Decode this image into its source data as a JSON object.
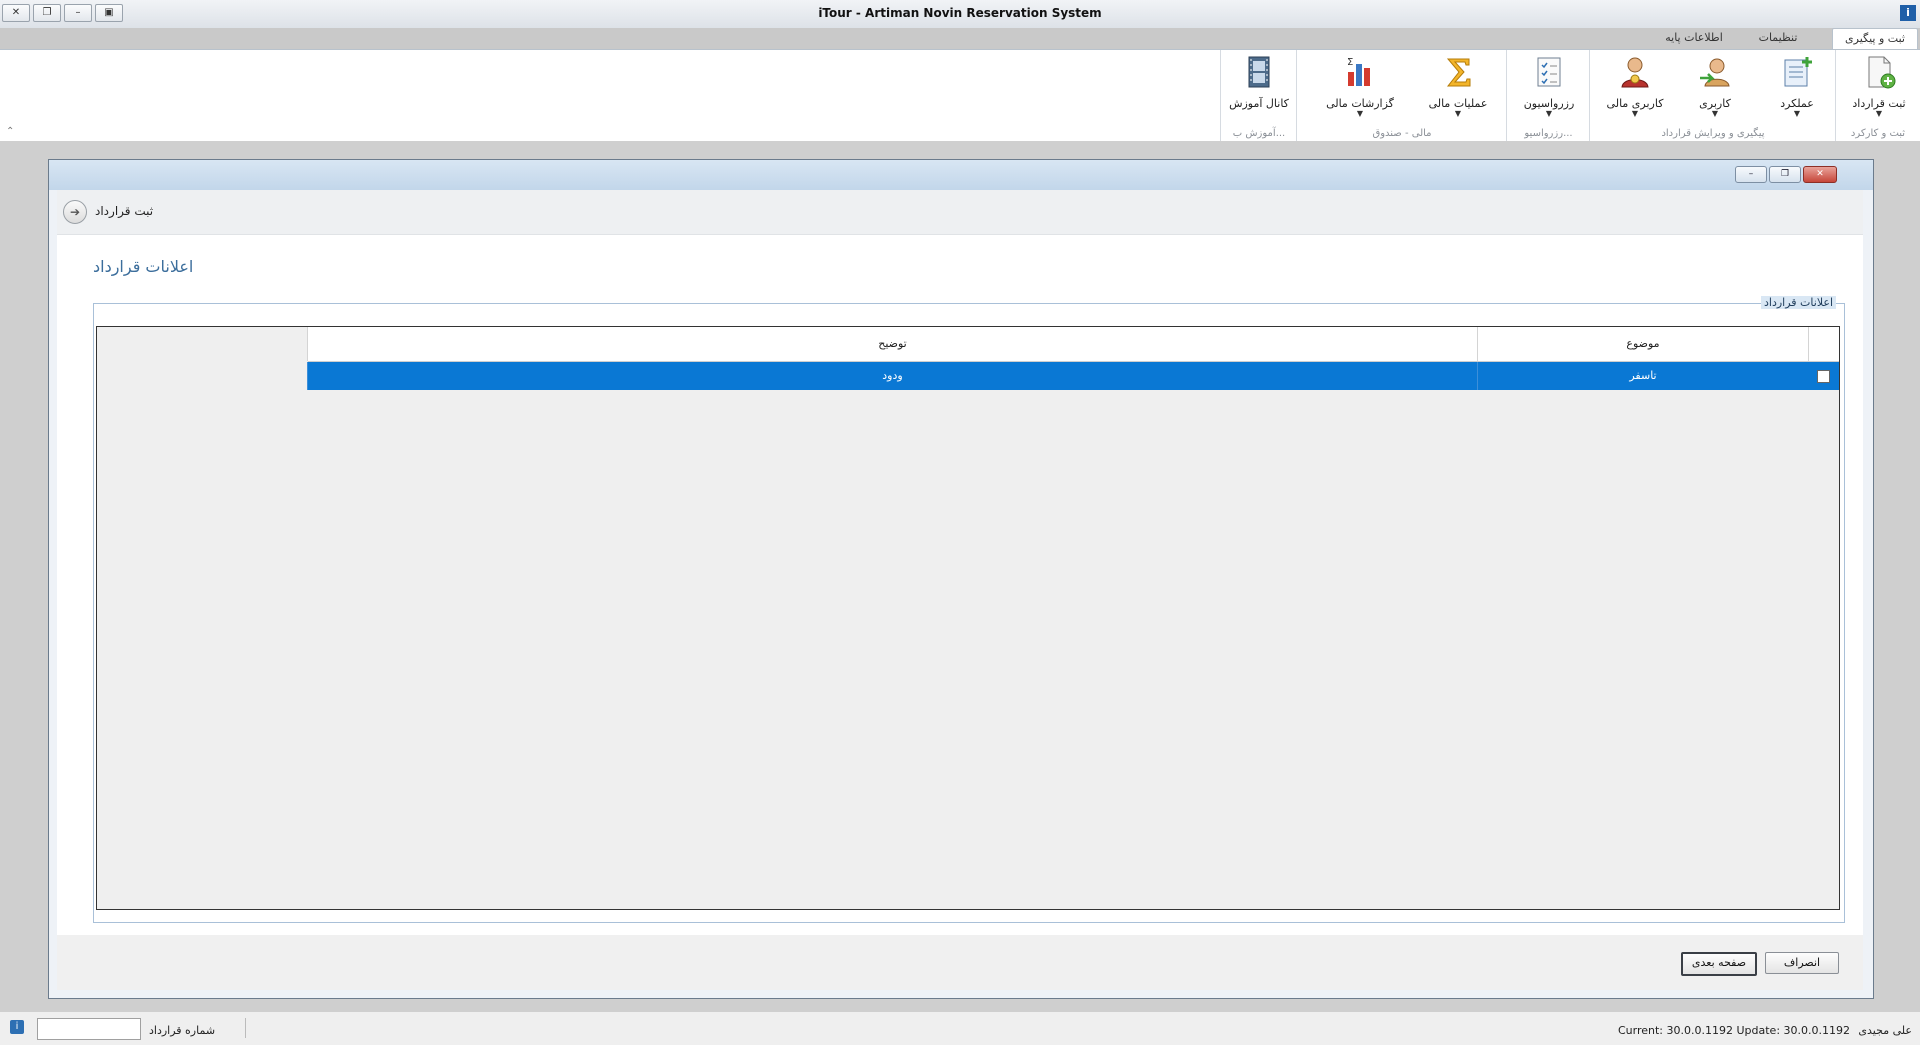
{
  "window": {
    "title": "iTour - Artiman Novin Reservation System"
  },
  "tabs": [
    {
      "label": "ثبت و پیگیری"
    },
    {
      "label": "تنظیمات"
    },
    {
      "label": "اطلاعات پایه"
    }
  ],
  "ribbon": {
    "groups": [
      {
        "label": "ثبت و کارکرد"
      },
      {
        "label": "پیگیری و ویرایش قرارداد"
      },
      {
        "label": "رزرواسیو..."
      },
      {
        "label": "مالی - صندوق"
      },
      {
        "label": "آموزش ب..."
      }
    ],
    "buttons": {
      "register_contract": "ثبت قرارداد",
      "performance": "عملکرد",
      "user": "کاربری",
      "financial_user": "کاربری مالی",
      "reservation": "رزرواسیون",
      "financial_ops": "عملیات مالی",
      "financial_reports": "گزارشات مالی",
      "training_channel": "کانال آموزش"
    }
  },
  "child_window": {
    "breadcrumb": "ثبت قرارداد",
    "page_title": "اعلانات قرارداد",
    "group_title": "اعلانات قرارداد",
    "grid": {
      "columns": {
        "subject": "موضوع",
        "description": "توضیح"
      },
      "rows": [
        {
          "subject": "تاسفر",
          "description": "ودود",
          "selected": true
        }
      ]
    },
    "buttons": {
      "next": "صفحه بعدی",
      "cancel": "انصراف"
    }
  },
  "status_bar": {
    "user": "علی مجیدی",
    "version": "Current: 30.0.0.1192 Update: 30.0.0.1192",
    "contract_number_label": "شماره قرارداد",
    "contract_number_value": ""
  },
  "colors": {
    "selection": "#0a78d4",
    "title_accent": "#3c6e9c"
  }
}
